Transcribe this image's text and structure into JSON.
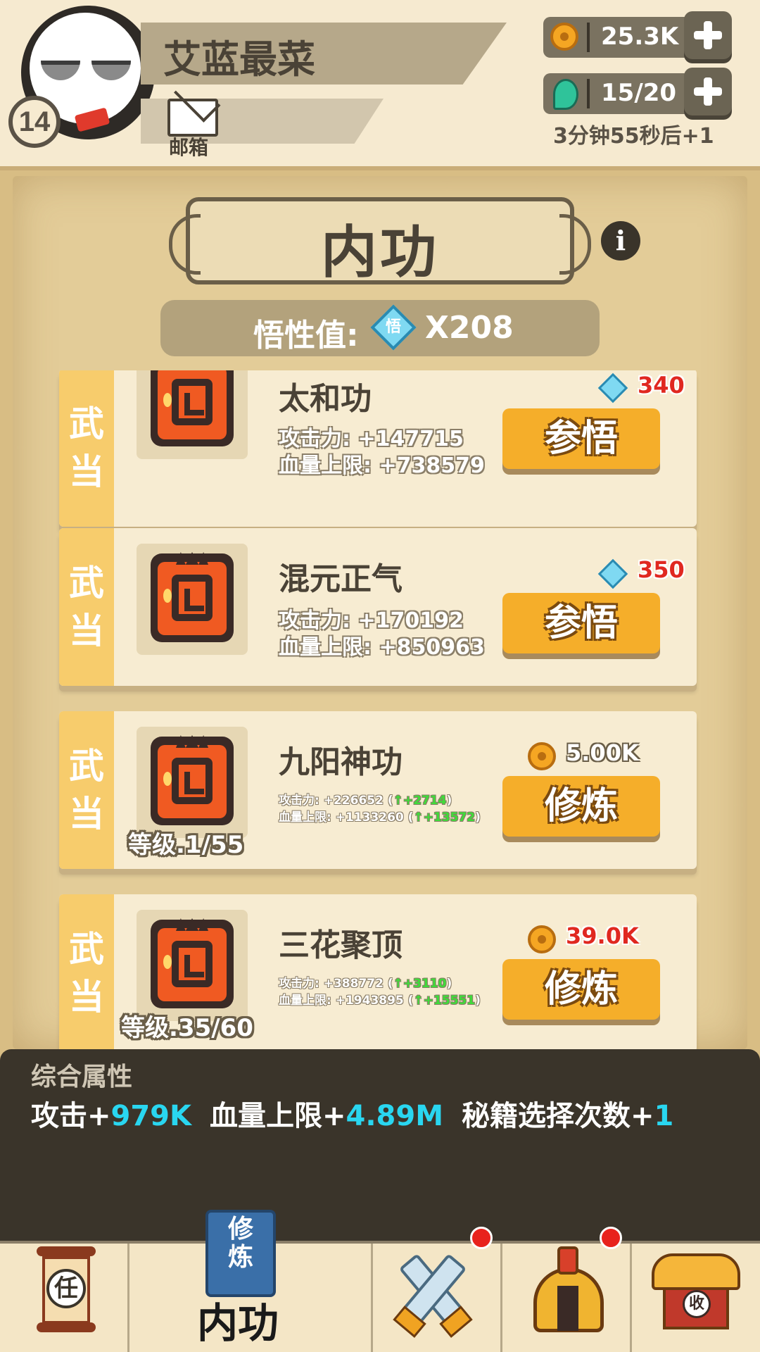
{
  "player": {
    "name": "艾蓝最菜",
    "level": "14",
    "mail_label": "邮箱"
  },
  "resources": {
    "coins": "25.3K",
    "energy": "15/20",
    "timer": "3分钟55秒后+1"
  },
  "page": {
    "title": "内功",
    "wuxing_label": "悟性值:",
    "wuxing_icon_text": "悟",
    "wuxing_value": "X208"
  },
  "skills": [
    {
      "sect": [
        "武",
        "当"
      ],
      "name": "太和功",
      "level": "",
      "atk": "攻击力: +147715",
      "hp": "血量上限: +738579",
      "cost_type": "wuxing",
      "cost": "340",
      "action": "参悟"
    },
    {
      "sect": [
        "武",
        "当"
      ],
      "name": "混元正气",
      "level": "",
      "atk": "攻击力: +170192",
      "hp": "血量上限: +850963",
      "cost_type": "wuxing",
      "cost": "350",
      "action": "参悟"
    },
    {
      "sect": [
        "武",
        "当"
      ],
      "name": "九阳神功",
      "level": "等级.1/55",
      "atk_base": "攻击力: +226652 (",
      "atk_up": "↑+2714",
      "hp_base": "血量上限: +1133260 (",
      "hp_up": "↑+13572",
      "close": ")",
      "cost_type": "coin",
      "cost": "5.00K",
      "action": "修炼"
    },
    {
      "sect": [
        "武",
        "当"
      ],
      "name": "三花聚顶",
      "level": "等级.35/60",
      "atk_base": "攻击力: +388772 (",
      "atk_up": "↑+3110",
      "hp_base": "血量上限: +1943895 (",
      "hp_up": "↑+15551",
      "close": ")",
      "cost_type": "coin",
      "cost": "39.0K",
      "action": "修炼"
    }
  ],
  "attributes": {
    "title": "综合属性",
    "atk_label": "攻击+",
    "atk_value": "979K",
    "hp_label": "血量上限+",
    "hp_value": "4.89M",
    "book_label": "秘籍选择次数+",
    "book_value": "1"
  },
  "nav": {
    "task_icon_text": "任",
    "book_icon_text": "修炼",
    "active_label": "内功",
    "shop_icon_text": "收"
  },
  "colors": {
    "accent_orange": "#f5ae2a",
    "cost_red": "#e02820",
    "cyan_value": "#29d6f0",
    "up_green": "#3fdc3a",
    "sect_tag": "#f7cc6c"
  }
}
